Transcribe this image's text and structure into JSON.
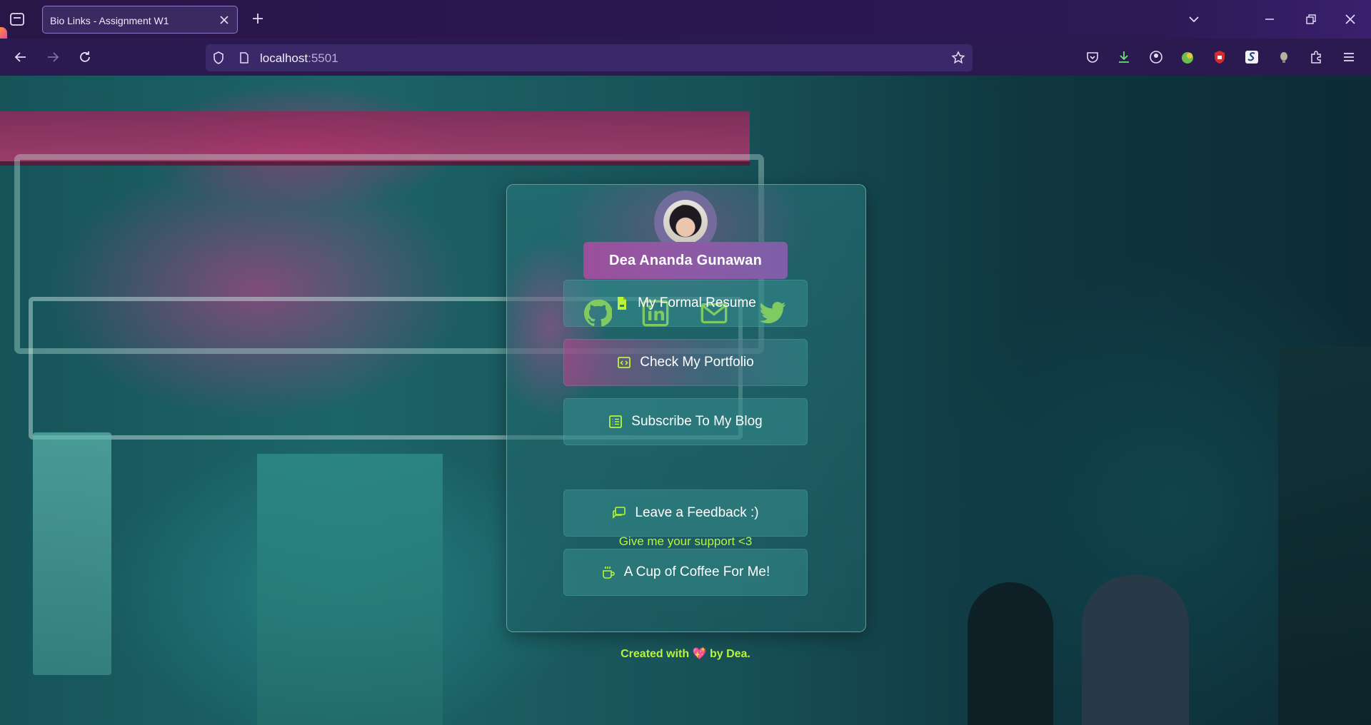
{
  "browser": {
    "tab_title": "Bio Links - Assignment W1",
    "url_host": "localhost",
    "url_port": ":5501"
  },
  "profile": {
    "name": "Dea Ananda Gunawan"
  },
  "social_icons": [
    "github-icon",
    "linkedin-icon",
    "mail-icon",
    "twitter-icon"
  ],
  "links": [
    {
      "label": "My Formal Resume",
      "icon": "document-icon"
    },
    {
      "label": "Check My Portfolio",
      "icon": "code-window-icon"
    },
    {
      "label": "Subscribe To My Blog",
      "icon": "list-icon"
    }
  ],
  "support": {
    "heading": "Give me your support <3",
    "links": [
      {
        "label": "Leave a Feedback :)",
        "icon": "chat-icon"
      },
      {
        "label": "A Cup of Coffee For Me!",
        "icon": "coffee-icon"
      }
    ]
  },
  "footer": {
    "prefix": "Created with",
    "heart": "💖",
    "suffix": "by Dea."
  },
  "colors": {
    "accent": "#b8f53a",
    "chrome_bg": "#2b1a50",
    "card_bg": "#2a7a7e"
  }
}
